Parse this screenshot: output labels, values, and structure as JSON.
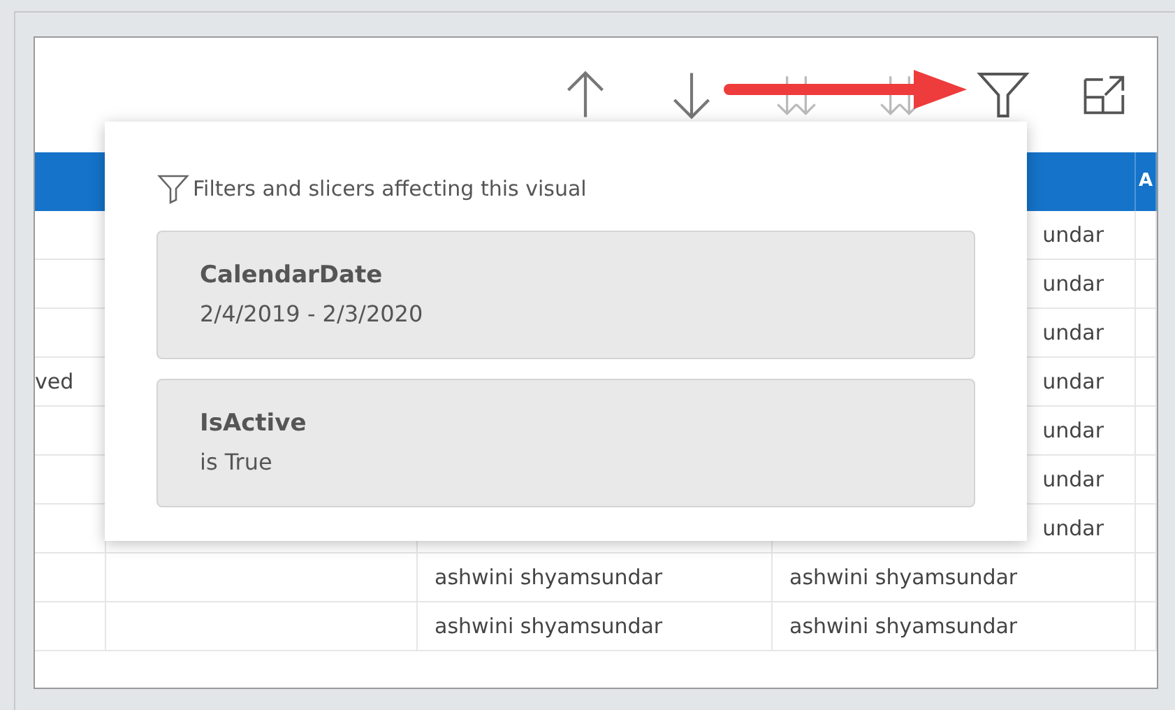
{
  "table": {
    "header": {
      "column_5": "A"
    },
    "rows": [
      {
        "column_4": "undar"
      },
      {
        "column_4": "undar"
      },
      {
        "column_4": "undar"
      },
      {
        "column_1": "ved",
        "column_4": "undar"
      },
      {
        "column_4": "undar"
      },
      {
        "column_4": "undar"
      },
      {
        "column_4": "undar"
      },
      {
        "column_3": "ashwini shyamsundar",
        "column_4": "ashwini shyamsundar"
      },
      {
        "column_3": "ashwini shyamsundar",
        "column_4": "ashwini shyamsundar"
      }
    ]
  },
  "filter_popup": {
    "title": "Filters and slicers affecting this visual",
    "filters": [
      {
        "name": "CalendarDate",
        "value": "2/4/2019 - 2/3/2020"
      },
      {
        "name": "IsActive",
        "value": "is True"
      }
    ]
  }
}
